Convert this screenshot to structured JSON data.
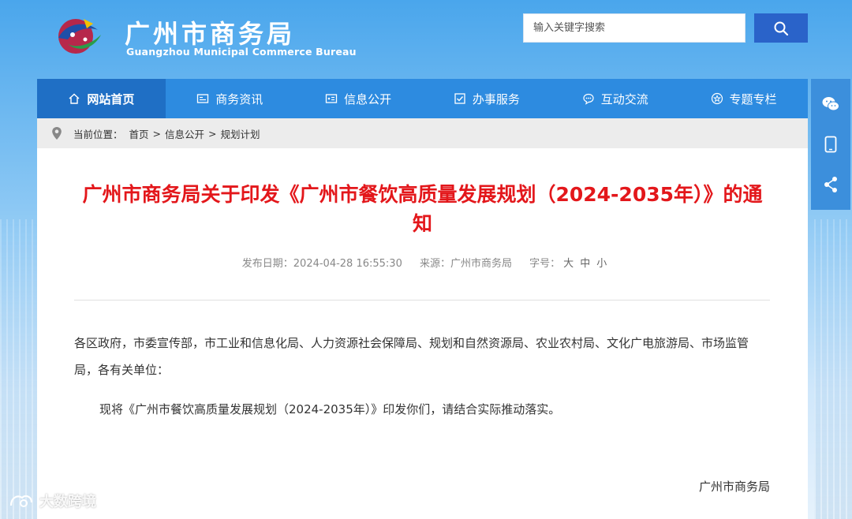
{
  "header": {
    "title": "广州市商务局",
    "subtitle": "Guangzhou Municipal Commerce Bureau",
    "search_placeholder": "输入关键字搜索"
  },
  "nav": {
    "items": [
      {
        "label": "网站首页",
        "icon": "home-icon",
        "active": true
      },
      {
        "label": "商务资讯",
        "icon": "news-icon"
      },
      {
        "label": "信息公开",
        "icon": "info-icon"
      },
      {
        "label": "办事服务",
        "icon": "checkbox-icon"
      },
      {
        "label": "互动交流",
        "icon": "chat-icon"
      },
      {
        "label": "专题专栏",
        "icon": "star-icon"
      }
    ]
  },
  "breadcrumb": {
    "prefix": "当前位置：",
    "items": [
      "首页",
      "信息公开",
      "规划计划"
    ],
    "separator": ">"
  },
  "article": {
    "title": "广州市商务局关于印发《广州市餐饮高质量发展规划（2024-2035年）》的通知",
    "publish_date": "发布日期：2024-04-28 16:55:30",
    "source": "来源：广州市商务局",
    "font_size_label": "字号：",
    "font_sizes": [
      "大",
      "中",
      "小"
    ],
    "paragraph1": "各区政府，市委宣传部，市工业和信息化局、人力资源社会保障局、规划和自然资源局、农业农村局、文化广电旅游局、市场监管局，各有关单位：",
    "paragraph2": "现将《广州市餐饮高质量发展规划（2024-2035年）》印发你们，请结合实际推动落实。",
    "signature": "广州市商务局"
  },
  "side_bar": {
    "buttons": [
      "wechat-icon",
      "mobile-icon",
      "share-icon"
    ]
  },
  "watermark": {
    "text": "大数跨境"
  },
  "colors": {
    "nav_bg": "#2d8be0",
    "nav_active": "#1f6fc5",
    "title_red": "#e3171b",
    "search_btn": "#2a63c9"
  }
}
